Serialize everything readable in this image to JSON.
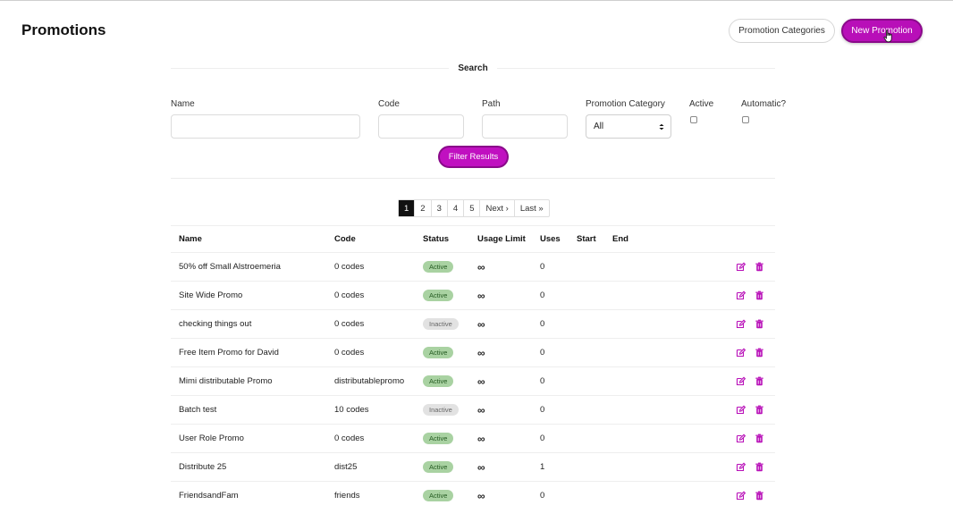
{
  "header": {
    "title": "Promotions",
    "categories_button": "Promotion Categories",
    "new_button": "New Promotion"
  },
  "search": {
    "legend": "Search",
    "fields": {
      "name_label": "Name",
      "code_label": "Code",
      "path_label": "Path",
      "category_label": "Promotion Category",
      "category_value": "All",
      "active_label": "Active",
      "automatic_label": "Automatic?"
    },
    "filter_button": "Filter Results"
  },
  "pagination": {
    "pages": [
      "1",
      "2",
      "3",
      "4",
      "5"
    ],
    "current": "1",
    "next": "Next ›",
    "last": "Last »"
  },
  "table": {
    "headers": [
      "Name",
      "Code",
      "Status",
      "Usage Limit",
      "Uses",
      "Start",
      "End"
    ],
    "rows": [
      {
        "name": "50% off Small Alstroemeria",
        "code": "0 codes",
        "status": "Active",
        "limit": "∞",
        "uses": "0"
      },
      {
        "name": "Site Wide Promo",
        "code": "0 codes",
        "status": "Active",
        "limit": "∞",
        "uses": "0"
      },
      {
        "name": "checking things out",
        "code": "0 codes",
        "status": "Inactive",
        "limit": "∞",
        "uses": "0"
      },
      {
        "name": "Free Item Promo for David",
        "code": "0 codes",
        "status": "Active",
        "limit": "∞",
        "uses": "0"
      },
      {
        "name": "Mimi distributable Promo",
        "code": "distributablepromo",
        "status": "Active",
        "limit": "∞",
        "uses": "0"
      },
      {
        "name": "Batch test",
        "code": "10 codes",
        "status": "Inactive",
        "limit": "∞",
        "uses": "0"
      },
      {
        "name": "User Role Promo",
        "code": "0 codes",
        "status": "Active",
        "limit": "∞",
        "uses": "0"
      },
      {
        "name": "Distribute 25",
        "code": "dist25",
        "status": "Active",
        "limit": "∞",
        "uses": "1"
      },
      {
        "name": "FriendsandFam",
        "code": "friends",
        "status": "Active",
        "limit": "∞",
        "uses": "0"
      }
    ]
  },
  "colors": {
    "accent": "#b80fb8",
    "accent_border": "#8a0a8a",
    "active_badge": "#a9d2a2",
    "inactive_badge": "#e2e2e2"
  },
  "icons": {
    "edit": "edit-icon",
    "delete": "trash-icon",
    "select": "select-arrows-icon",
    "cursor": "hand-pointer-icon"
  }
}
